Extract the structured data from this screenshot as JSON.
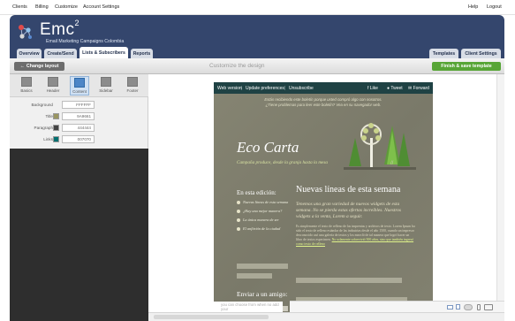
{
  "topbar": {
    "left_links": [
      "Clients",
      "Billing",
      "Customize",
      "Account Settings"
    ],
    "right_links": [
      "Help",
      "Logout"
    ]
  },
  "header": {
    "brand": "Emc",
    "brand_sup": "2",
    "tagline": "Email Marketing Campaigns Colombia",
    "tabs": [
      "Overview",
      "Create/Send",
      "Lists & Subscribers",
      "Reports"
    ],
    "active_tab": "Lists & Subscribers",
    "right_tabs": [
      "Templates",
      "Client Settings"
    ]
  },
  "actionbar": {
    "back_label": "Change layout",
    "title": "Customize the design",
    "finish_label": "Finish & save template"
  },
  "left_panel": {
    "tools": [
      {
        "label": "Basics",
        "icon": "basics-icon"
      },
      {
        "label": "Header",
        "icon": "header-icon"
      },
      {
        "label": "Content",
        "icon": "content-icon"
      },
      {
        "label": "Sidebar",
        "icon": "sidebar-icon"
      },
      {
        "label": "Footer",
        "icon": "footer-icon"
      }
    ],
    "active_tool": "Content",
    "properties": [
      {
        "label": "Background",
        "value": "FFFFFF",
        "color": "#FFFFFF"
      },
      {
        "label": "Title",
        "value": "9A9661",
        "color": "#9A9661"
      },
      {
        "label": "Paragraph",
        "value": "444444",
        "color": "#444444"
      },
      {
        "label": "Links",
        "value": "007070",
        "color": "#007070"
      }
    ]
  },
  "email": {
    "bar_links": [
      "Web version",
      "Update preferences",
      "Unsubscribe"
    ],
    "share": [
      "Like",
      "Tweet",
      "Forward"
    ],
    "note_1": "Estás recibiendo este boletín porque usted compró algo con nosotros.",
    "note_2": "¿Tiene problemas para leer este boletín? Vea en su navegador web.",
    "title": "Eco Carta",
    "subtitle": "Campaña produce, desde la granja hasta la mesa",
    "left_title": "En esta edición:",
    "left_items": [
      "Nuevas líneas de esta semana",
      "¿Hay una mejor manera?",
      "La única manera de ser",
      "El anfitrión de la ciudad"
    ],
    "main_title": "Nuevas líneas de esta semana",
    "main_lead": "Tenemos una gran variedad de nuevos widgets de esta semana. No se pierda estas ofertas increíbles. Nuestros widgets a la venta, Lorem a seguir.",
    "main_body_1": "Es simplemente el texto de relleno de las imprentas y archivos de texto. Lorem Ipsum ha sido el texto de relleno estándar de las industrias desde el año 1500, cuando un impresor desconocido usó una galería de textos y los mezcló de tal manera que logró hacer un libro de textos especimen.",
    "main_body_link": "No solamente sobrevivió 500 años, sino que también ingresó como texto de relleno",
    "send_title": "Enviar a un amigo:",
    "send_text": "you can choose from when no add your"
  },
  "colors": {
    "header_bg": "#34466d",
    "finish_bg": "#57a536",
    "email_bar": "#1f4244",
    "email_bg": "#7f7e6e"
  }
}
